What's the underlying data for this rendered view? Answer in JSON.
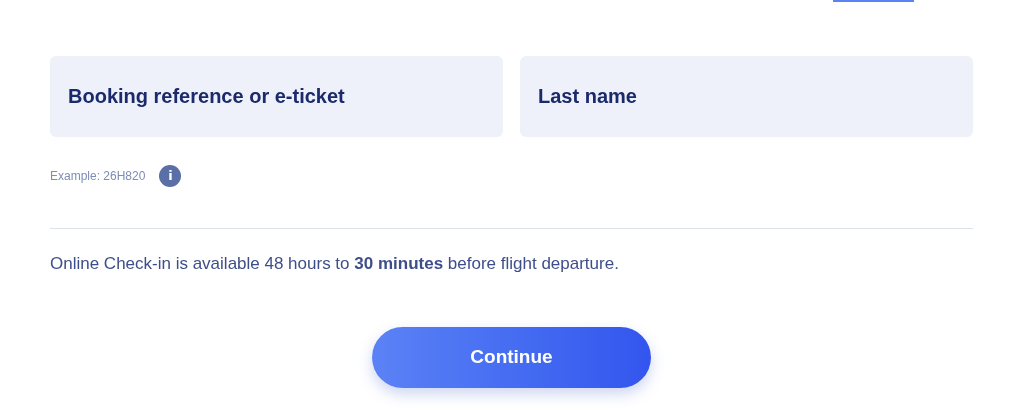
{
  "fields": [
    {
      "placeholder": "Booking reference or e-ticket"
    },
    {
      "placeholder": "Last name"
    }
  ],
  "hint": "Example: 26H820",
  "info_icon": "i",
  "notice": "Online Check-in is available 48 hours to **30 minutes** before flight departure.",
  "button": "Continue"
}
